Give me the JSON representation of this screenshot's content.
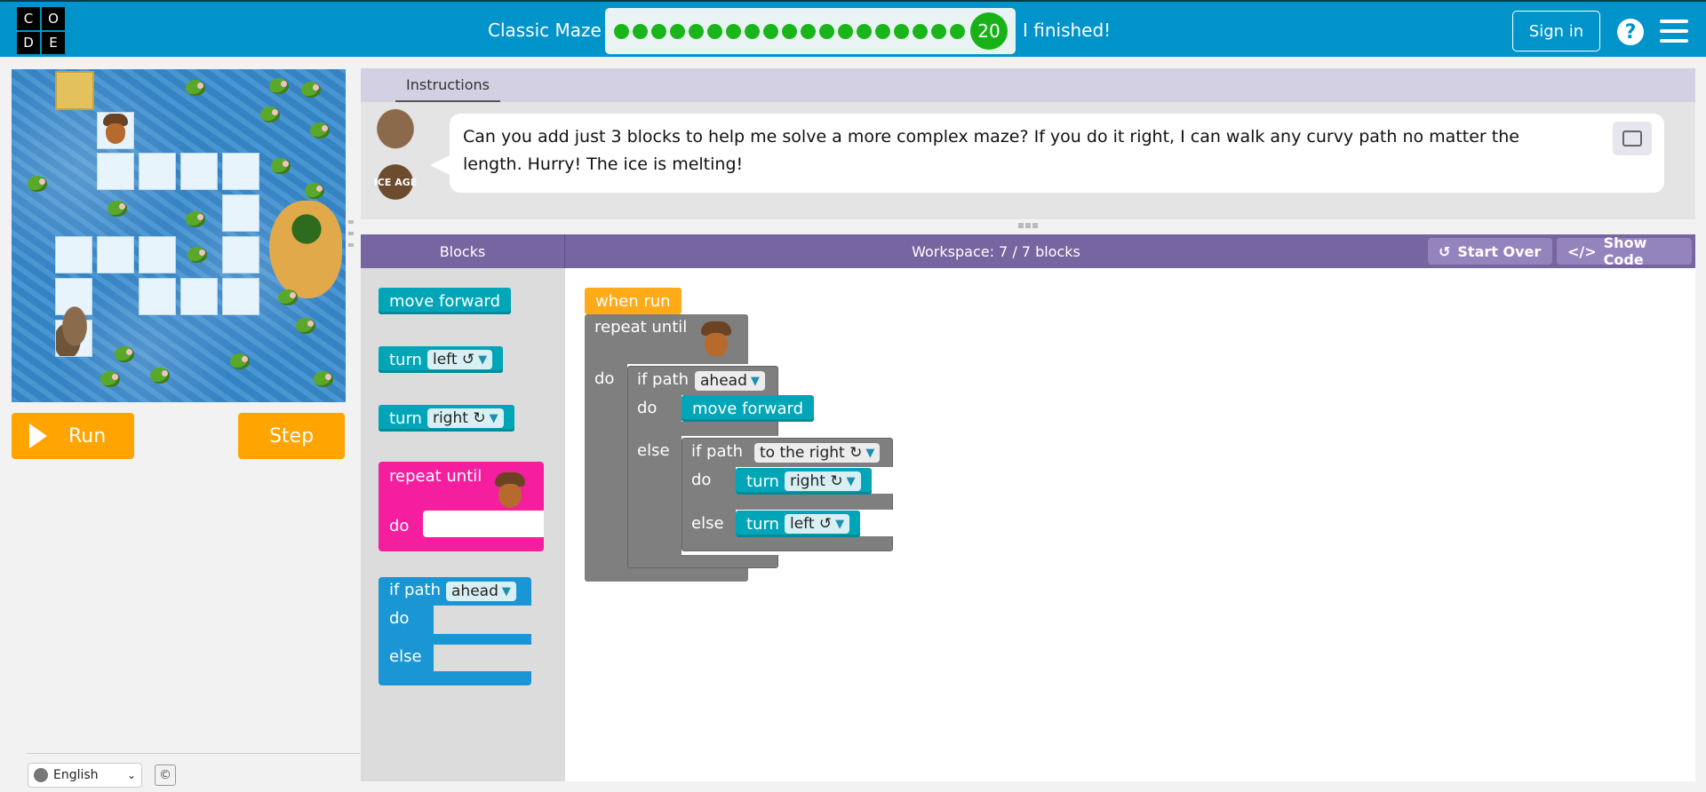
{
  "header": {
    "logo_letters": [
      "C",
      "O",
      "D",
      "E"
    ],
    "lesson_title": "Classic Maze",
    "progress": {
      "completed_dots": 19,
      "current_level": "20"
    },
    "finished_label": "I finished!",
    "sign_in_label": "Sign in",
    "help_label": "?",
    "colors": {
      "bar": "#0094ca",
      "progress_green": "#1ab51a"
    }
  },
  "maze": {
    "icons": [
      "acorn-icon",
      "squirrel-icon",
      "lily-pad-icon",
      "ice-tile-icon",
      "island-icon"
    ]
  },
  "controls": {
    "run_label": "Run",
    "step_label": "Step"
  },
  "footer": {
    "language": "English",
    "copyright_symbol": "©"
  },
  "instructions": {
    "tab_label": "Instructions",
    "text": "Can you add just 3 blocks to help me solve a more complex maze? If you do it right, I can walk any curvy path no matter the length. Hurry! The ice is melting!",
    "avatar_logo": "ICE AGE"
  },
  "workspace_header": {
    "blocks_label": "Blocks",
    "workspace_label": "Workspace: 7 / 7 blocks",
    "start_over_label": "Start Over",
    "show_code_label": "Show Code"
  },
  "toolbox": {
    "move_forward": "move forward",
    "turn_left": {
      "label": "turn",
      "value": "left ↺"
    },
    "turn_right": {
      "label": "turn",
      "value": "right ↻"
    },
    "repeat_until": {
      "label": "repeat until",
      "do": "do"
    },
    "if_path": {
      "label": "if path",
      "value": "ahead",
      "do": "do",
      "else": "else"
    }
  },
  "program": {
    "when_run": "when run",
    "repeat_until": "repeat until",
    "do": "do",
    "if1": {
      "label": "if path",
      "value": "ahead",
      "do": "do",
      "else": "else"
    },
    "move_forward": "move forward",
    "if2": {
      "label": "if path",
      "value": "to the right ↻",
      "do": "do",
      "else": "else"
    },
    "turn_right": {
      "label": "turn",
      "value": "right ↻"
    },
    "turn_left": {
      "label": "turn",
      "value": "left ↺"
    }
  },
  "colors": {
    "action_block": "#00a6b8",
    "loop_block": "#f41e9f",
    "if_block": "#1b96d4",
    "run_button": "#ffa400",
    "workspace_bar": "#7665a0"
  }
}
